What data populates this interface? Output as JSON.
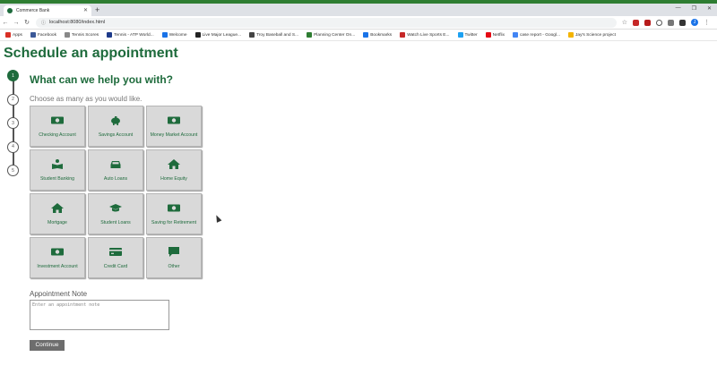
{
  "browser": {
    "tab_title": "Commerce Bank",
    "url": "localhost:8080/index.html",
    "profile_initial": "J",
    "bookmarks": [
      {
        "label": "Apps",
        "color": "#d93025"
      },
      {
        "label": "Facebook",
        "color": "#3b5998"
      },
      {
        "label": "Tennis Scores",
        "color": "#888888"
      },
      {
        "label": "Tennis - ATP World...",
        "color": "#1e3a8a"
      },
      {
        "label": "Welcome",
        "color": "#1a73e8"
      },
      {
        "label": "Live Major League...",
        "color": "#222222"
      },
      {
        "label": "Troy Baseball and S...",
        "color": "#444444"
      },
      {
        "label": "Planning Center On...",
        "color": "#2e7d32"
      },
      {
        "label": "Bookmarks",
        "color": "#1a73e8"
      },
      {
        "label": "Watch Live Sports E...",
        "color": "#c62828"
      },
      {
        "label": "Twitter",
        "color": "#1da1f2"
      },
      {
        "label": "Netflix",
        "color": "#e50914"
      },
      {
        "label": "case report - Googl...",
        "color": "#4285f4"
      },
      {
        "label": "Jay's Science project",
        "color": "#f4b400"
      }
    ]
  },
  "page": {
    "title": "Schedule an appointment",
    "question": "What can we help you with?",
    "hint": "Choose as many as you would like.",
    "steps": [
      "1",
      "2",
      "3",
      "4",
      "5"
    ],
    "active_step": 1,
    "accent_color": "#1e6b3c",
    "services": [
      {
        "label": "Checking Account",
        "icon": "money-icon"
      },
      {
        "label": "Savings Account",
        "icon": "piggy-bank-icon"
      },
      {
        "label": "Money Market Account",
        "icon": "money-icon"
      },
      {
        "label": "Student Banking",
        "icon": "book-reader-icon"
      },
      {
        "label": "Auto Loans",
        "icon": "car-icon"
      },
      {
        "label": "Home Equity",
        "icon": "home-icon"
      },
      {
        "label": "Mortgage",
        "icon": "home-icon"
      },
      {
        "label": "Student Loans",
        "icon": "graduation-cap-icon"
      },
      {
        "label": "Saving for Retirement",
        "icon": "money-icon"
      },
      {
        "label": "Investment Account",
        "icon": "money-icon"
      },
      {
        "label": "Credit Card",
        "icon": "credit-card-icon"
      },
      {
        "label": "Other",
        "icon": "comment-icon"
      }
    ],
    "note_label": "Appointment Note",
    "note_placeholder": "Enter an appointment note",
    "continue_label": "Continue"
  }
}
